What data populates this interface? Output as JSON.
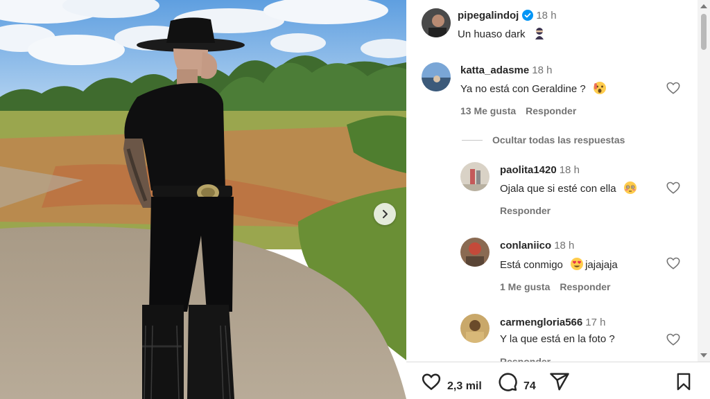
{
  "post": {
    "author": "pipegalindoj",
    "time": "18 h",
    "caption": "Un huaso dark"
  },
  "comments": [
    {
      "user": "katta_adasme",
      "time": "18 h",
      "text": "Ya no está con Geraldine ?",
      "likes": "13 Me gusta",
      "reply": "Responder"
    },
    {
      "user": "paolita1420",
      "time": "18 h",
      "text": "Ojala que si esté con ella",
      "reply": "Responder"
    },
    {
      "user": "conlaniico",
      "time": "18 h",
      "text": "Está conmigo",
      "text_after": "jajajaja",
      "likes": "1 Me gusta",
      "reply": "Responder"
    },
    {
      "user": "carmengloria566",
      "time": "17 h",
      "text": "Y la que está en la foto ?",
      "reply": "Responder"
    }
  ],
  "hide_replies": "Ocultar todas las respuestas",
  "actions": {
    "likes_count": "2,3 mil",
    "comments_count": "74"
  },
  "icons": [
    "verified-icon",
    "heart-icon",
    "comment-icon",
    "share-icon",
    "bookmark-icon",
    "chevron-right-icon"
  ],
  "colors": {
    "verified": "#0095f6",
    "muted": "#737373",
    "text": "#262626"
  }
}
